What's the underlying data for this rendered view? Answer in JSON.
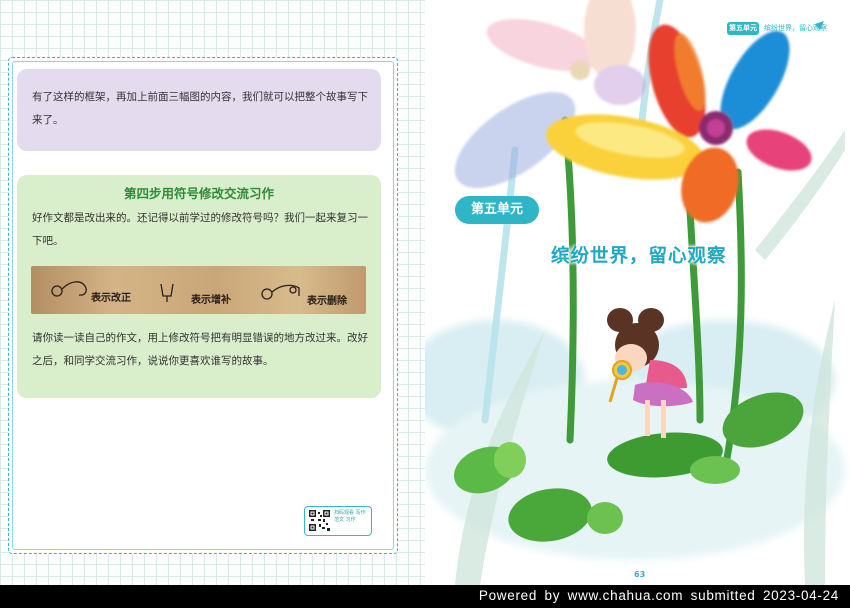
{
  "left_page": {
    "panel1_text": "有了这样的框架，再加上前面三幅图的内容，我们就可以把整个故事写下来了。",
    "step4_title": "第四步用符号修改交流习作",
    "step4_intro": "好作文都是改出来的。还记得以前学过的修改符号吗？我们一起来复习一下吧。",
    "symbols": [
      "表示改正",
      "表示增补",
      "表示删除"
    ],
    "step4_instruction": "请你读一读自己的作文，用上修改符号把有明显错误的地方改过来。改好之后，和同学交流习作，说说你更喜欢谁写的故事。",
    "qr_caption": "扫码观看 写作范文 习作"
  },
  "right_page": {
    "header_badge": "第五单元",
    "header_theme": "缤纷世界，留心观察",
    "unit_label": "第五单元",
    "unit_title": "缤纷世界，留心观察",
    "page_number": "63"
  },
  "footer": {
    "text": "Powered by www.chahua.com submitted 2023-04-24"
  },
  "colors": {
    "accent_teal": "#2eb6c7",
    "title_green": "#2e8b3a",
    "panel_purple": "#e5dbee",
    "panel_green": "#d9eecb"
  }
}
